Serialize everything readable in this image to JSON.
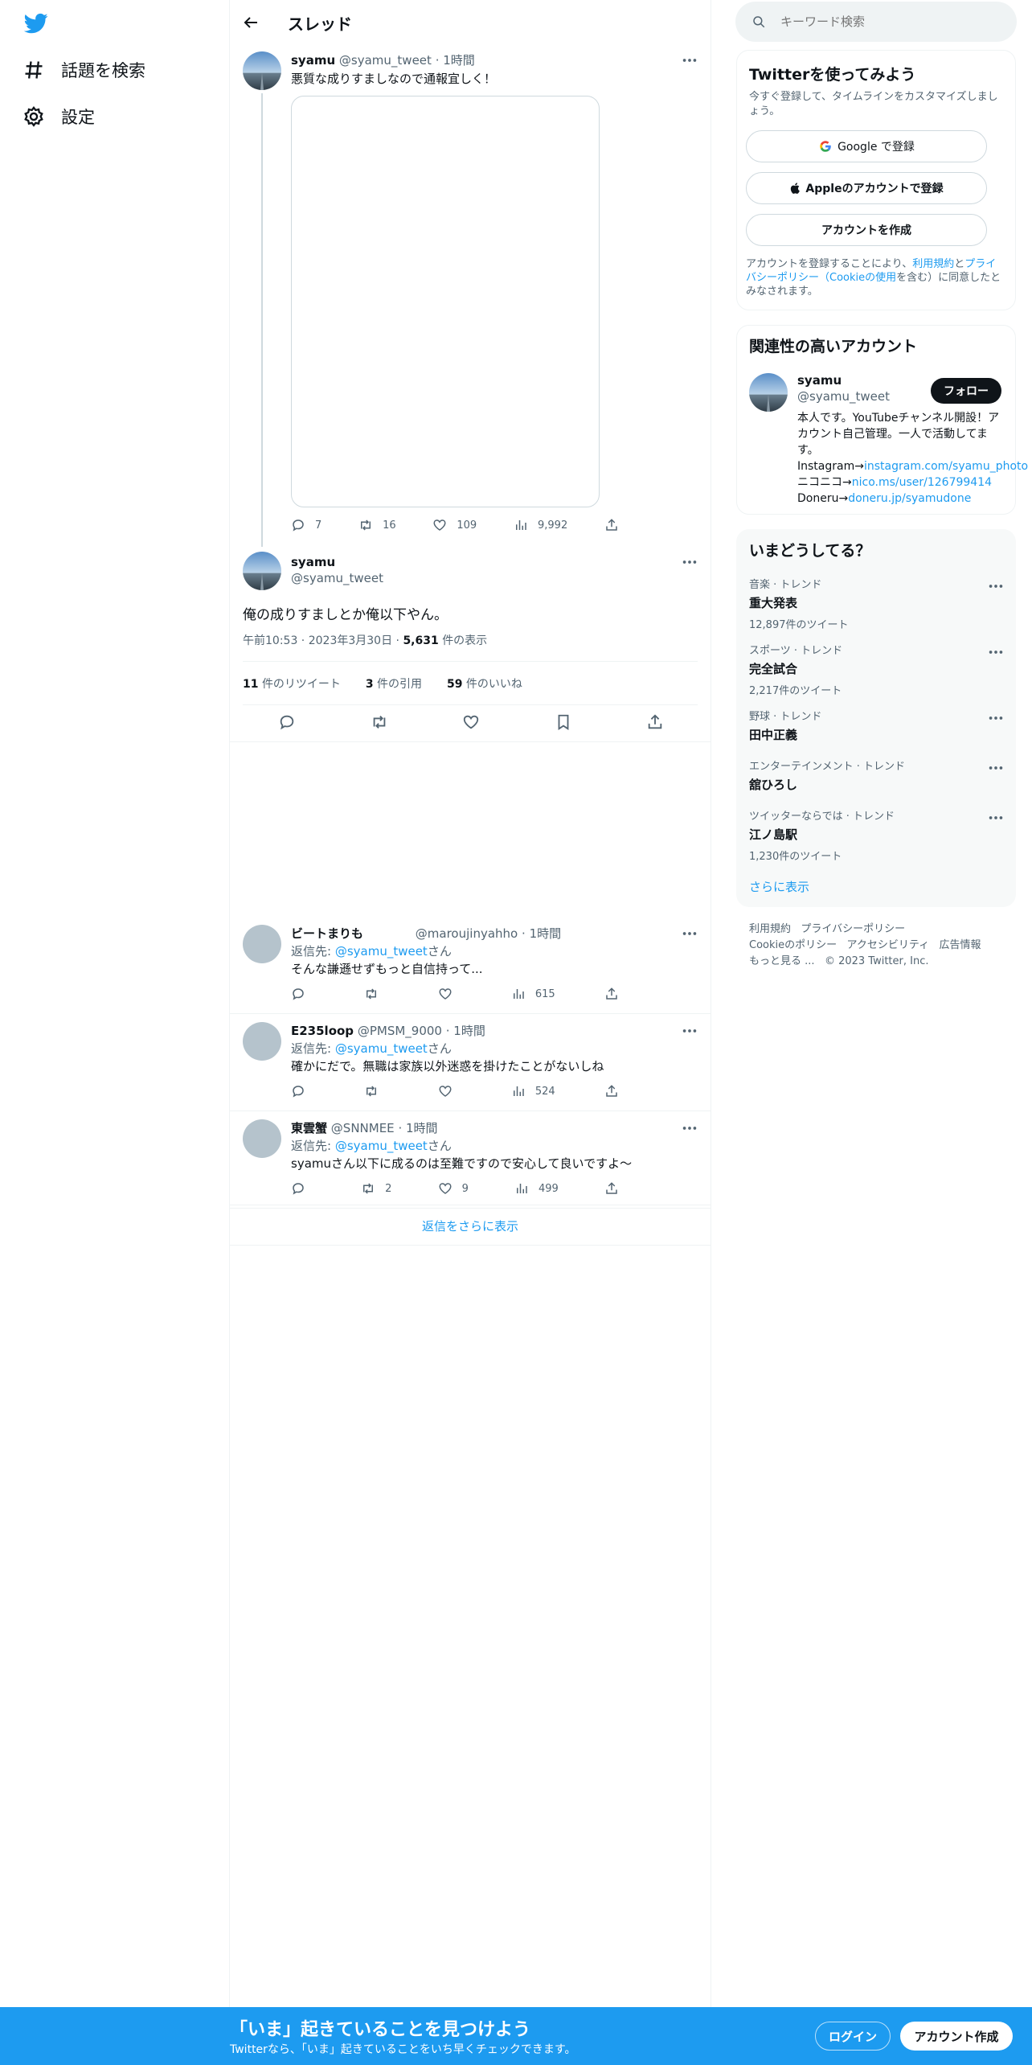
{
  "nav": {
    "explore": "話題を検索",
    "settings": "設定"
  },
  "header": {
    "title": "スレッド"
  },
  "search": {
    "placeholder": "キーワード検索"
  },
  "parent_tweet": {
    "name": "syamu",
    "handle": "@syamu_tweet",
    "time": "1時間",
    "text": "悪質な成りすましなので通報宜しく！",
    "replies": "7",
    "retweets": "16",
    "likes": "109",
    "views": "9,992"
  },
  "main_tweet": {
    "name": "syamu",
    "handle": "@syamu_tweet",
    "text": "俺の成りすましとか俺以下やん。",
    "time": "午前10:53",
    "date": "2023年3月30日",
    "views_num": "5,631",
    "views_label": "件の表示",
    "retweets_num": "11",
    "retweets_label": "件のリツイート",
    "quotes_num": "3",
    "quotes_label": "件の引用",
    "likes_num": "59",
    "likes_label": "件のいいね"
  },
  "replies": [
    {
      "name": "ビートまりも",
      "handle": "@maroujinyahho",
      "time": "1時間",
      "reply_prefix": "返信先: ",
      "reply_to": "@syamu_tweet",
      "reply_suffix": "さん",
      "text": "そんな謙遜せずもっと自信持って...",
      "replies": "",
      "retweets": "",
      "likes": "",
      "views": "615"
    },
    {
      "name": "E235loop",
      "handle": "@PMSM_9000",
      "time": "1時間",
      "reply_prefix": "返信先: ",
      "reply_to": "@syamu_tweet",
      "reply_suffix": "さん",
      "text": "確かにだで。無職は家族以外迷惑を掛けたことがないしね",
      "replies": "",
      "retweets": "",
      "likes": "",
      "views": "524"
    },
    {
      "name": "東雲蟹",
      "handle": "@SNNMEE",
      "time": "1時間",
      "reply_prefix": "返信先: ",
      "reply_to": "@syamu_tweet",
      "reply_suffix": "さん",
      "text": "syamuさん以下に成るのは至難ですので安心して良いですよ〜",
      "replies": "",
      "retweets": "2",
      "likes": "9",
      "views": "499"
    }
  ],
  "show_more_replies": "返信をさらに表示",
  "signup": {
    "title": "Twitterを使ってみよう",
    "subtitle": "今すぐ登録して、タイムラインをカスタマイズしましょう。",
    "google": "Google で登録",
    "apple": "Appleのアカウントで登録",
    "create": "アカウントを作成",
    "legal_1": "アカウントを登録することにより、",
    "legal_terms": "利用規約",
    "legal_2": "と",
    "legal_privacy": "プライバシーポリシー（Cookieの使用",
    "legal_3": "を含む）に同意したとみなされます。"
  },
  "related": {
    "title": "関連性の高いアカウント",
    "name": "syamu",
    "handle": "@syamu_tweet",
    "follow": "フォロー",
    "bio_1": "本人です。YouTubeチャンネル開設！アカウント自己管理。一人で活動してます。 Instagram→",
    "bio_link1": "instagram.com/syamu_photo",
    "bio_2": " ニコニコ→",
    "bio_link2": "nico.ms/user/126799414",
    "bio_3": "Doneru→",
    "bio_link3": "doneru.jp/syamudone"
  },
  "trends": {
    "title": "いまどうしてる？",
    "items": [
      {
        "category": "音楽 · トレンド",
        "name": "重大発表",
        "count": "12,897件のツイート"
      },
      {
        "category": "スポーツ · トレンド",
        "name": "完全試合",
        "count": "2,217件のツイート"
      },
      {
        "category": "野球 · トレンド",
        "name": "田中正義",
        "count": ""
      },
      {
        "category": "エンターテインメント · トレンド",
        "name": "舘ひろし",
        "count": ""
      },
      {
        "category": "ツイッターならでは · トレンド",
        "name": "江ノ島駅",
        "count": "1,230件のツイート"
      }
    ],
    "show_more": "さらに表示"
  },
  "footer": {
    "terms": "利用規約",
    "privacy": "プライバシーポリシー",
    "cookie": "Cookieのポリシー",
    "accessibility": "アクセシビリティ",
    "ads": "広告情報",
    "more": "もっと見る ...",
    "copyright": "© 2023 Twitter, Inc."
  },
  "bottom": {
    "title": "「いま」起きていることを見つけよう",
    "subtitle": "Twitterなら、「いま」起きていることをいち早くチェックできます。",
    "login": "ログイン",
    "signup": "アカウント作成"
  },
  "colors": {
    "accent": "#1d9bf0",
    "text": "#0f1419",
    "muted": "#536471"
  }
}
